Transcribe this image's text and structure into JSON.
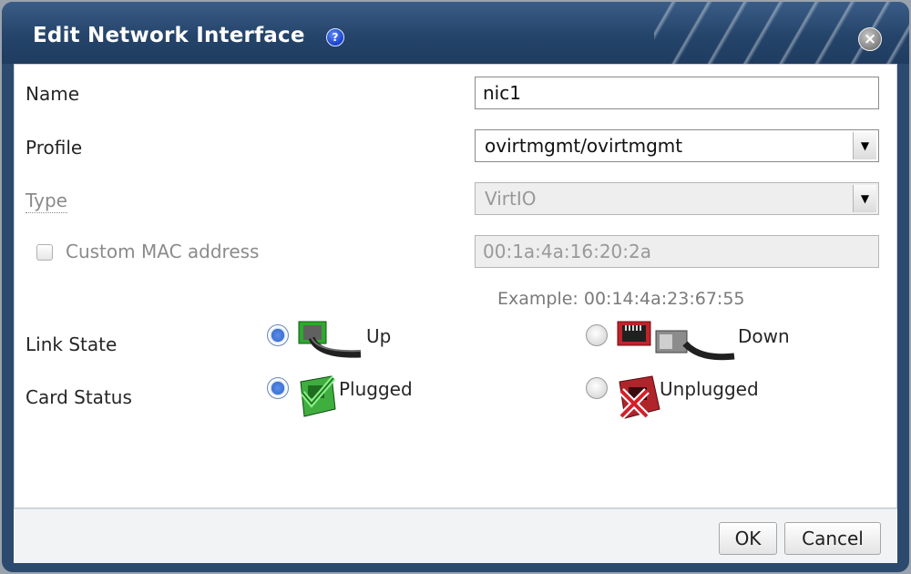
{
  "dialog": {
    "title": "Edit Network Interface",
    "help_glyph": "?",
    "close_glyph": "×"
  },
  "form": {
    "name_label": "Name",
    "name_value": "nic1",
    "profile_label": "Profile",
    "profile_value": "ovirtmgmt/ovirtmgmt",
    "type_label": "Type",
    "type_value": "VirtIO",
    "custom_mac_label": "Custom MAC address",
    "custom_mac_checked": false,
    "mac_value": "00:1a:4a:16:20:2a",
    "mac_example": "Example: 00:14:4a:23:67:55",
    "link_state_label": "Link State",
    "link_up_label": "Up",
    "link_down_label": "Down",
    "link_state_selected": "Up",
    "card_status_label": "Card Status",
    "plugged_label": "Plugged",
    "unplugged_label": "Unplugged",
    "card_status_selected": "Plugged"
  },
  "footer": {
    "ok_label": "OK",
    "cancel_label": "Cancel"
  },
  "colors": {
    "titlebar": "#25446a",
    "radio_selected": "#3f73d2",
    "link_up_green": "#2fa82f",
    "link_down_red": "#c0232b"
  },
  "icons": {
    "help": "help-icon",
    "close": "close-icon",
    "dropdown": "chevron-down-icon",
    "link_up": "network-cable-plugged-icon",
    "link_down": "network-cable-unplugged-icon",
    "plugged": "network-card-plugged-icon",
    "unplugged": "network-card-unplugged-icon"
  }
}
